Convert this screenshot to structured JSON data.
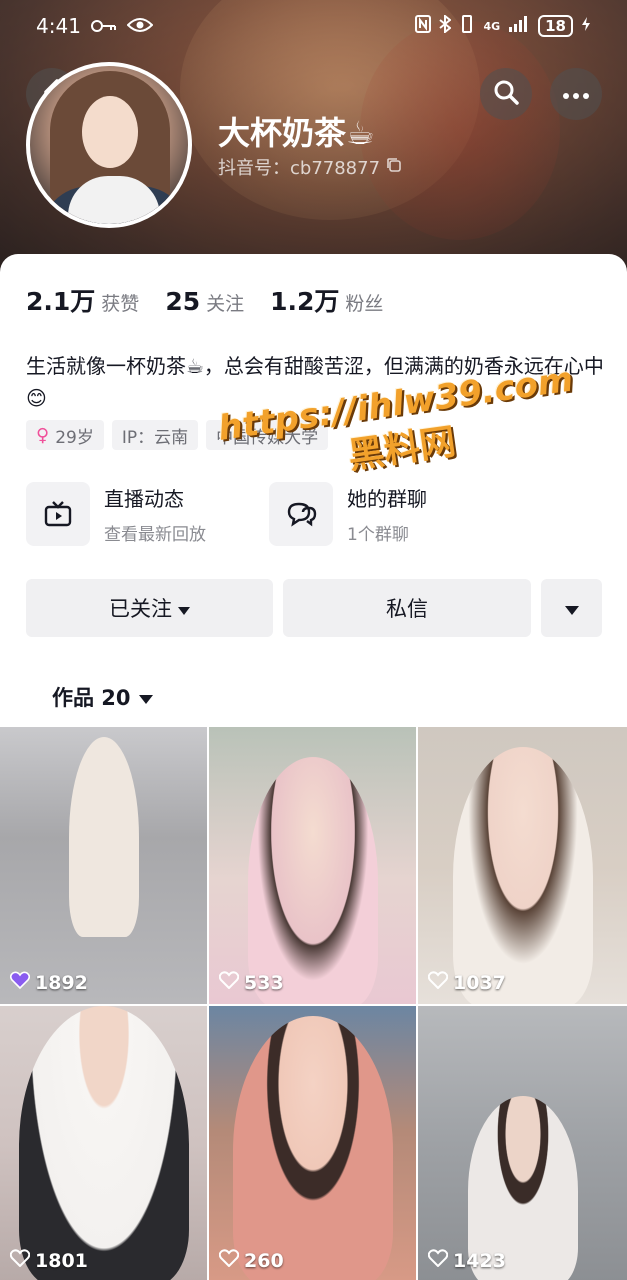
{
  "status_bar": {
    "time": "4:41",
    "battery": "18",
    "network": "4G"
  },
  "profile": {
    "name": "大杯奶茶☕",
    "douyin_id": "抖音号：cb778877"
  },
  "stats": [
    {
      "value": "2.1万",
      "label": "获赞"
    },
    {
      "value": "25",
      "label": "关注"
    },
    {
      "value": "1.2万",
      "label": "粉丝"
    }
  ],
  "bio": "生活就像一杯奶茶☕，总会有甜酸苦涩，但满满的奶香永远在心中😊",
  "tags": [
    {
      "text": "29岁",
      "icon": "female-icon"
    },
    {
      "text": "IP：云南"
    },
    {
      "text": "中国传媒大学"
    }
  ],
  "features": [
    {
      "title": "直播动态",
      "sub": "查看最新回放",
      "icon": "tv-icon"
    },
    {
      "title": "她的群聊",
      "sub": "1个群聊",
      "icon": "chat-icon"
    }
  ],
  "buttons": {
    "follow": "已关注",
    "message": "私信"
  },
  "works_tab": "作品 20",
  "watermark": {
    "url": "https://ihlw39.com",
    "brand": "黑料网"
  },
  "videos": [
    {
      "likes": "1892"
    },
    {
      "likes": "533"
    },
    {
      "likes": "1037"
    },
    {
      "likes": "1801"
    },
    {
      "likes": "260"
    },
    {
      "likes": "1423"
    }
  ],
  "colors": {
    "accent_pink": "#f0509a",
    "watermark": "#f2a12b"
  }
}
